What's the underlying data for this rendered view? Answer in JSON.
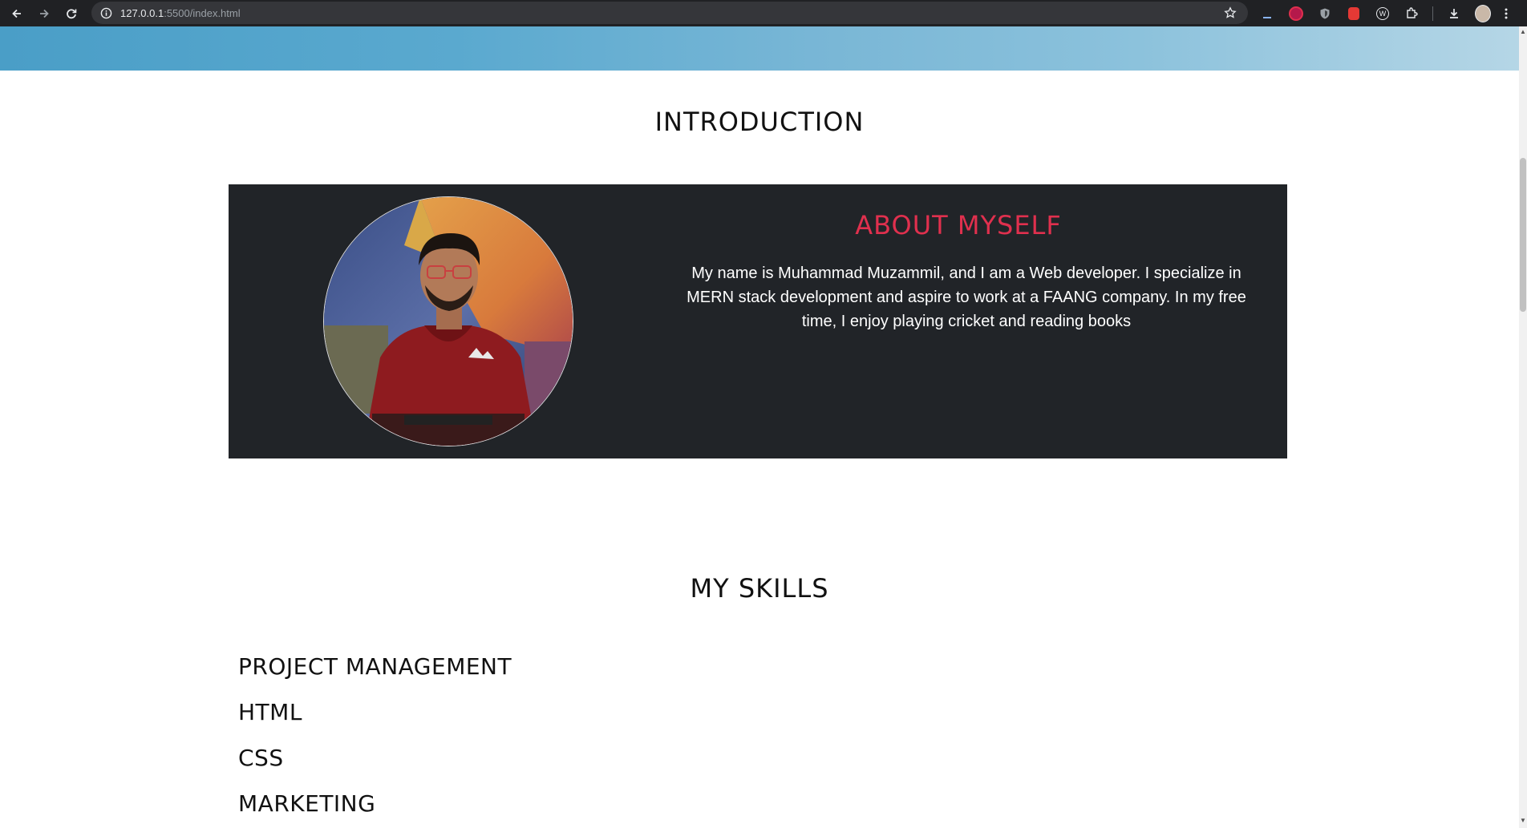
{
  "browser": {
    "url_host": "127.0.0.1",
    "url_path": ":5500/index.html"
  },
  "intro": {
    "title": "INTRODUCTION",
    "about_heading": "ABOUT MYSELF",
    "about_text": "My name is Muhammad Muzammil, and I am a Web developer. I specialize in MERN stack development and aspire to work at a FAANG company. In my free time, I enjoy playing cricket and reading books"
  },
  "skills": {
    "title": "MY SKILLS",
    "items": [
      "PROJECT MANAGEMENT",
      "HTML",
      "CSS",
      "MARKETING"
    ]
  },
  "colors": {
    "accent": "#e0304e",
    "card_bg": "#212428"
  }
}
